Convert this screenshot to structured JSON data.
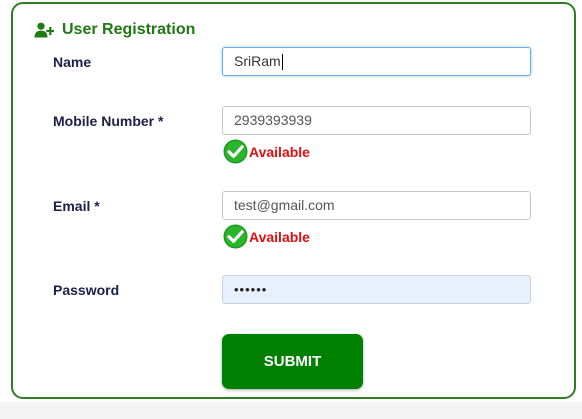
{
  "form": {
    "title": "User Registration",
    "icon": "user-plus-icon",
    "accent_color": "#1e7a12",
    "fields": {
      "name": {
        "label": "Name",
        "value": "SriRam"
      },
      "mobile": {
        "label": "Mobile Number *",
        "value": "2939393939",
        "status": "Available",
        "status_icon": "check-circle-icon"
      },
      "email": {
        "label": "Email *",
        "value": "test@gmail.com",
        "status": "Available",
        "status_icon": "check-circle-icon"
      },
      "password": {
        "label": "Password",
        "value": "••••••"
      }
    },
    "submit_label": "SUBMIT",
    "status_color": "#e01010",
    "submit_color": "#008000"
  }
}
